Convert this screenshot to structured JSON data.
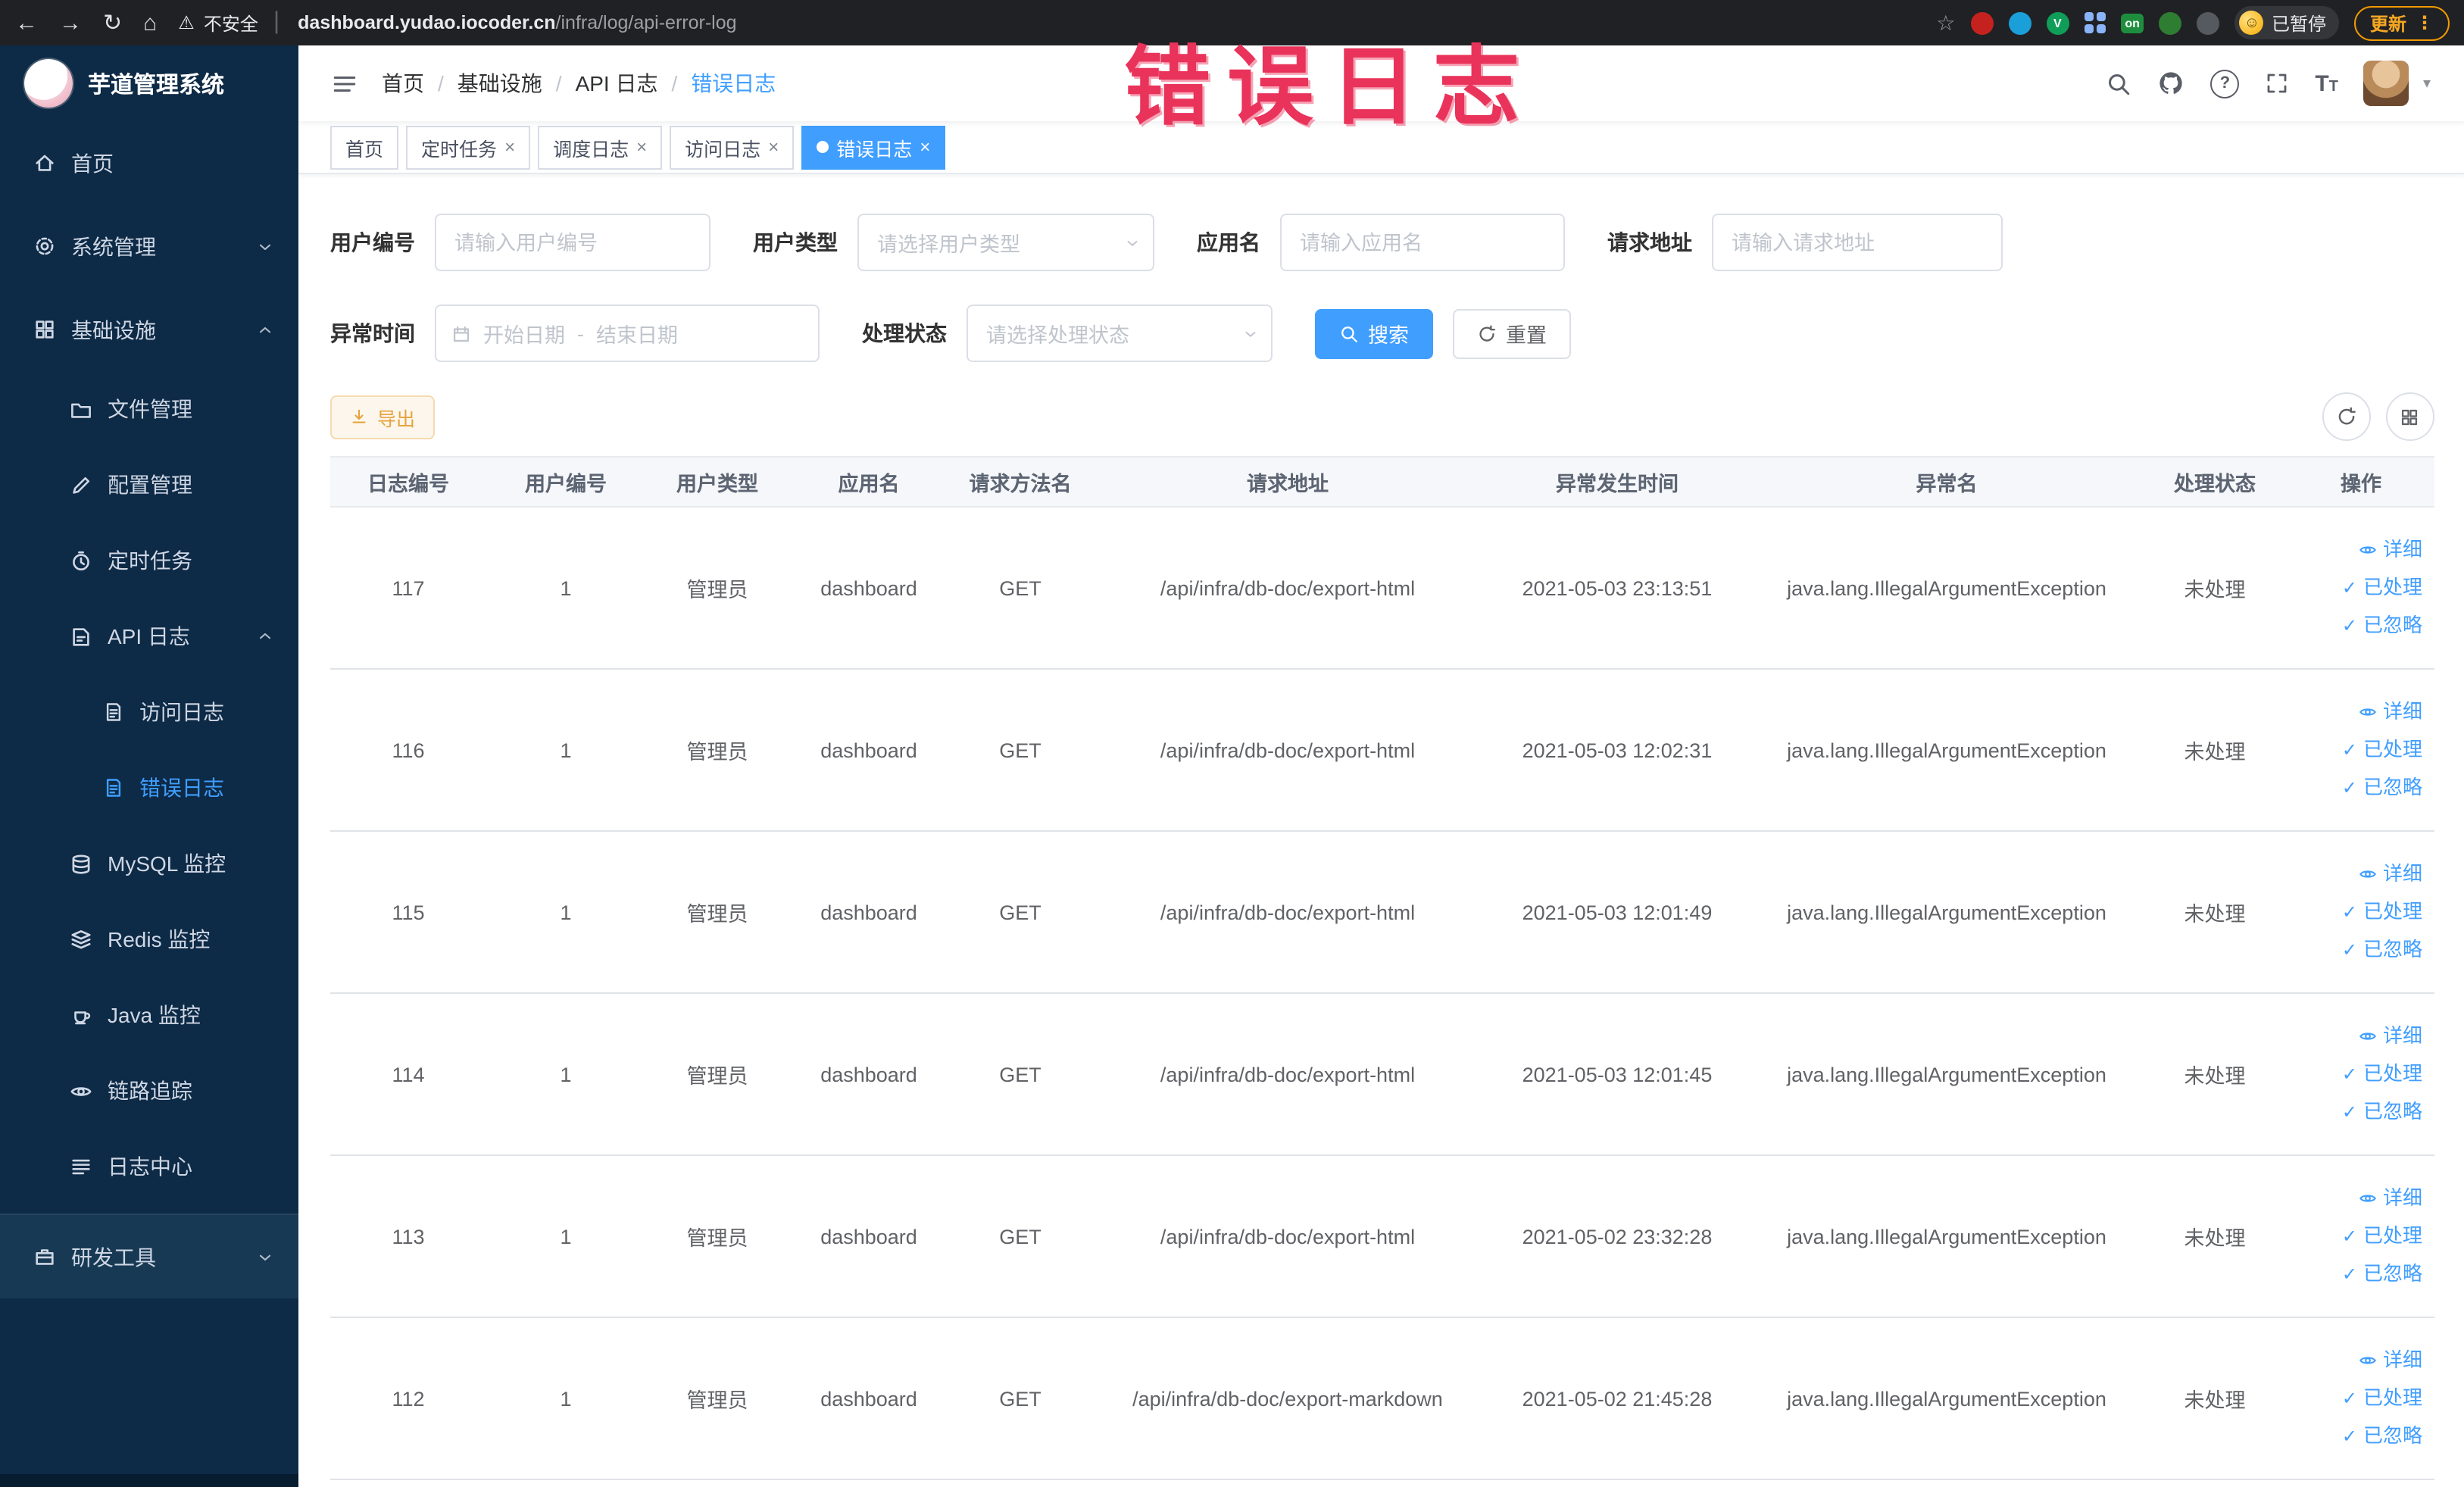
{
  "browser": {
    "security_label": "不安全",
    "url_domain": "dashboard.yudao.iocoder.cn",
    "url_path": "/infra/log/api-error-log",
    "paused_button": "已暂停",
    "update_button": "更新",
    "ext_v_label": "V",
    "ext_on_label": "on"
  },
  "annotation": {
    "text": "错误日志",
    "color": "#e9335a"
  },
  "sidebar": {
    "logo_title": "芋道管理系统",
    "items": [
      {
        "label": "首页"
      },
      {
        "label": "系统管理"
      },
      {
        "label": "基础设施"
      },
      {
        "label": "文件管理"
      },
      {
        "label": "配置管理"
      },
      {
        "label": "定时任务"
      },
      {
        "label": "API 日志"
      },
      {
        "label": "访问日志"
      },
      {
        "label": "错误日志"
      },
      {
        "label": "MySQL 监控"
      },
      {
        "label": "Redis 监控"
      },
      {
        "label": "Java 监控"
      },
      {
        "label": "链路追踪"
      },
      {
        "label": "日志中心"
      },
      {
        "label": "研发工具"
      }
    ]
  },
  "navbar": {
    "breadcrumb": [
      "首页",
      "基础设施",
      "API 日志",
      "错误日志"
    ]
  },
  "tabs": [
    {
      "label": "首页"
    },
    {
      "label": "定时任务"
    },
    {
      "label": "调度日志"
    },
    {
      "label": "访问日志"
    },
    {
      "label": "错误日志"
    }
  ],
  "filters": {
    "user_id_label": "用户编号",
    "user_id_placeholder": "请输入用户编号",
    "user_type_label": "用户类型",
    "user_type_placeholder": "请选择用户类型",
    "app_name_label": "应用名",
    "app_name_placeholder": "请输入应用名",
    "request_url_label": "请求地址",
    "request_url_placeholder": "请输入请求地址",
    "exception_time_label": "异常时间",
    "start_date_placeholder": "开始日期",
    "range_separator": "-",
    "end_date_placeholder": "结束日期",
    "process_status_label": "处理状态",
    "process_status_placeholder": "请选择处理状态",
    "search_button": "搜索",
    "reset_button": "重置"
  },
  "toolbar": {
    "export_button": "导出"
  },
  "table": {
    "headers": [
      "日志编号",
      "用户编号",
      "用户类型",
      "应用名",
      "请求方法名",
      "请求地址",
      "异常发生时间",
      "异常名",
      "处理状态",
      "操作"
    ],
    "action_labels": {
      "detail": "详细",
      "processed": "已处理",
      "ignored": "已忽略"
    },
    "rows": [
      {
        "log_id": "117",
        "user_id": "1",
        "user_type": "管理员",
        "app_name": "dashboard",
        "method": "GET",
        "url": "/api/infra/db-doc/export-html",
        "time": "2021-05-03 23:13:51",
        "exception": "java.lang.IllegalArgumentException",
        "status": "未处理"
      },
      {
        "log_id": "116",
        "user_id": "1",
        "user_type": "管理员",
        "app_name": "dashboard",
        "method": "GET",
        "url": "/api/infra/db-doc/export-html",
        "time": "2021-05-03 12:02:31",
        "exception": "java.lang.IllegalArgumentException",
        "status": "未处理"
      },
      {
        "log_id": "115",
        "user_id": "1",
        "user_type": "管理员",
        "app_name": "dashboard",
        "method": "GET",
        "url": "/api/infra/db-doc/export-html",
        "time": "2021-05-03 12:01:49",
        "exception": "java.lang.IllegalArgumentException",
        "status": "未处理"
      },
      {
        "log_id": "114",
        "user_id": "1",
        "user_type": "管理员",
        "app_name": "dashboard",
        "method": "GET",
        "url": "/api/infra/db-doc/export-html",
        "time": "2021-05-03 12:01:45",
        "exception": "java.lang.IllegalArgumentException",
        "status": "未处理"
      },
      {
        "log_id": "113",
        "user_id": "1",
        "user_type": "管理员",
        "app_name": "dashboard",
        "method": "GET",
        "url": "/api/infra/db-doc/export-html",
        "time": "2021-05-02 23:32:28",
        "exception": "java.lang.IllegalArgumentException",
        "status": "未处理"
      },
      {
        "log_id": "112",
        "user_id": "1",
        "user_type": "管理员",
        "app_name": "dashboard",
        "method": "GET",
        "url": "/api/infra/db-doc/export-markdown",
        "time": "2021-05-02 21:45:28",
        "exception": "java.lang.IllegalArgumentException",
        "status": "未处理"
      }
    ]
  },
  "colors": {
    "accent": "#409eff",
    "sidebar_bg": "#0d2a46",
    "warning": "#e6a23c",
    "annotation_red": "#e9335a"
  }
}
